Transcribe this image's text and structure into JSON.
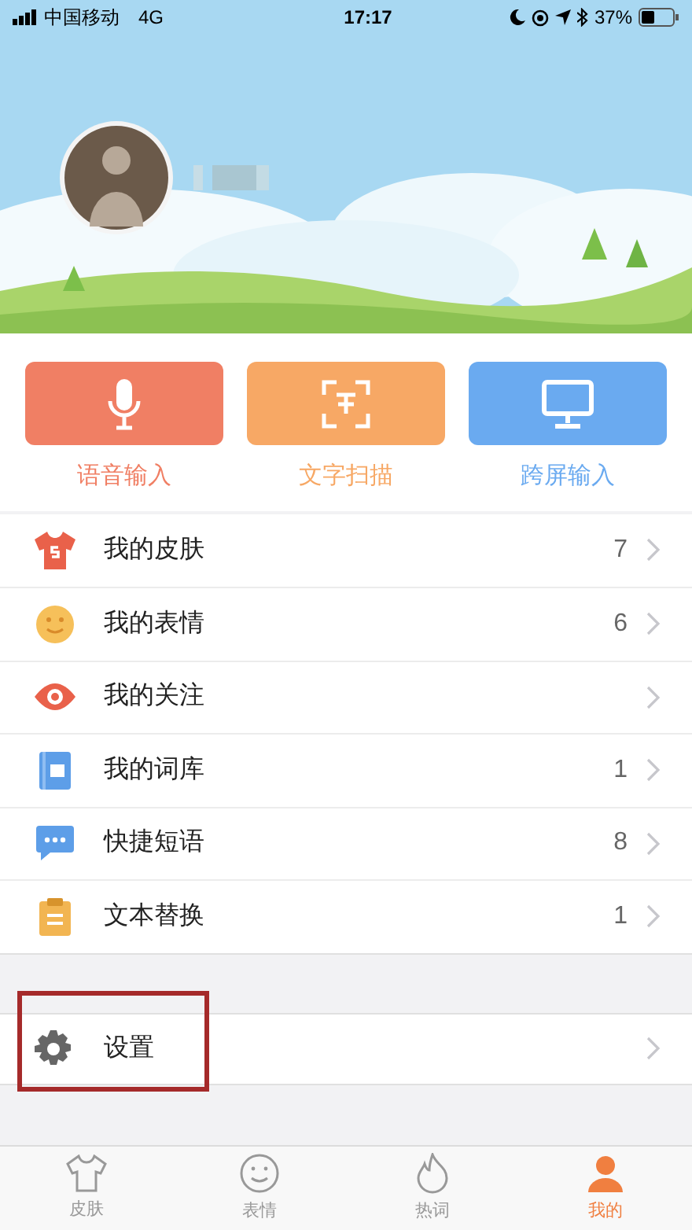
{
  "status_bar": {
    "carrier": "中国移动",
    "network": "4G",
    "time": "17:17",
    "battery": "37%"
  },
  "quick_actions": [
    {
      "kind": "voice",
      "label": "语音输入",
      "color": "#f07f64"
    },
    {
      "kind": "scan",
      "label": "文字扫描",
      "color": "#f7a865"
    },
    {
      "kind": "screen",
      "label": "跨屏输入",
      "color": "#6aaaf0"
    }
  ],
  "menu": [
    {
      "kind": "skin",
      "label": "我的皮肤",
      "count": "7"
    },
    {
      "kind": "emoji",
      "label": "我的表情",
      "count": "6"
    },
    {
      "kind": "follow",
      "label": "我的关注"
    },
    {
      "kind": "dict",
      "label": "我的词库",
      "count": "1"
    },
    {
      "kind": "phrase",
      "label": "快捷短语",
      "count": "8"
    },
    {
      "kind": "replace",
      "label": "文本替换",
      "count": "1"
    }
  ],
  "settings": {
    "label": "设置",
    "highlighted": true
  },
  "tab_bar": [
    {
      "kind": "skin",
      "label": "皮肤",
      "selected": false
    },
    {
      "kind": "emoji",
      "label": "表情",
      "selected": false
    },
    {
      "kind": "hot",
      "label": "热词",
      "selected": false
    },
    {
      "kind": "me",
      "label": "我的",
      "selected": true
    }
  ]
}
